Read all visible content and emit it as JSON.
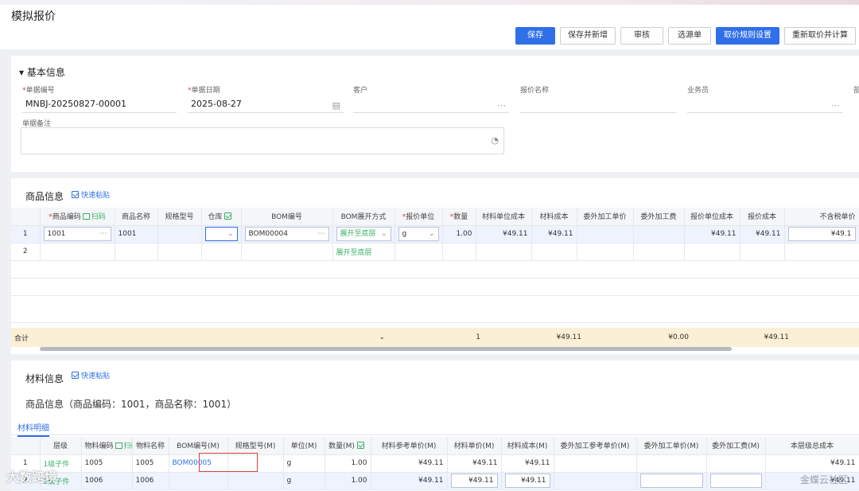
{
  "page": {
    "title": "模拟报价"
  },
  "toolbar": {
    "buttons": [
      "保存",
      "保存并新增",
      "审核",
      "选源单",
      "取价规则设置",
      "重新取价并计算",
      "​"
    ]
  },
  "basic": {
    "section_title": "基本信息",
    "fields": [
      {
        "label": "单据编号",
        "required": true,
        "value": "MNBJ-20250827-00001",
        "icon": ""
      },
      {
        "label": "单据日期",
        "required": true,
        "value": "2025-08-27",
        "icon": "calendar-icon"
      },
      {
        "label": "客户",
        "required": false,
        "value": "",
        "icon": "more-icon"
      },
      {
        "label": "报价名称",
        "required": false,
        "value": "",
        "icon": ""
      },
      {
        "label": "业务员",
        "required": false,
        "value": "",
        "icon": "more-icon"
      },
      {
        "label": "部",
        "required": false,
        "value": "",
        "icon": ""
      }
    ],
    "remark_label": "单据备注"
  },
  "goods": {
    "section_title": "商品信息",
    "quick_paste": "快速粘贴",
    "scan_label": "扫码",
    "columns": [
      "",
      "商品编码",
      "商品名称",
      "规格型号",
      "仓库",
      "BOM编号",
      "BOM展开方式",
      "报价单位",
      "数量",
      "材料单位成本",
      "材料成本",
      "委外加工单价",
      "委外加工费",
      "报价单位成本",
      "报价成本",
      "不含税单价"
    ],
    "rows": [
      {
        "no": "1",
        "code": "1001",
        "name": "1001",
        "spec": "",
        "warehouse": "",
        "bom": "BOM00004",
        "bom_expand": "展开至底层",
        "unit": "g",
        "qty": "1.00",
        "mat_unit_cost": "¥49.11",
        "mat_cost": "¥49.11",
        "out_price": "",
        "out_fee": "",
        "quote_unit_cost": "¥49.11",
        "quote_cost": "¥49.11",
        "ex_tax_price": "¥49.1"
      },
      {
        "no": "2",
        "code": "",
        "name": "",
        "spec": "",
        "warehouse": "",
        "bom": "",
        "bom_expand": "展开至底层",
        "unit": "",
        "qty": "",
        "mat_unit_cost": "",
        "mat_cost": "",
        "out_price": "",
        "out_fee": "",
        "quote_unit_cost": "",
        "quote_cost": "",
        "ex_tax_price": ""
      }
    ],
    "sum": {
      "label": "合计",
      "qty": "1",
      "mat_cost": "¥49.11",
      "out_fee": "¥0.00",
      "quote_cost": "¥49.11"
    }
  },
  "material": {
    "section_title": "材料信息",
    "quick_paste": "快速粘贴",
    "goods_line": "商品信息（商品编码：1001，商品名称：1001）",
    "tab": "材料明细",
    "columns": [
      "",
      "层级",
      "物料编码",
      "物料名称",
      "BOM编号(M)",
      "规格型号(M)",
      "单位(M)",
      "数量(M)",
      "材料参考单价(M)",
      "材料单价(M)",
      "材料成本(M)",
      "委外加工参考单价(M)",
      "委外加工单价(M)",
      "委外加工费(M)",
      "本层级总成本"
    ],
    "rows": [
      {
        "no": "1",
        "level": "1级子件",
        "code": "1005",
        "name": "1005",
        "bom": "BOM00005",
        "spec": "",
        "unit": "g",
        "qty": "1.00",
        "ref_price": "¥49.11",
        "price": "¥49.11",
        "cost": "¥49.11",
        "out_ref": "",
        "out_price": "",
        "out_fee": "",
        "total": "¥49.11"
      },
      {
        "no": "2",
        "level": "2级子件",
        "code": "1006",
        "name": "1006",
        "bom": "",
        "spec": "",
        "unit": "g",
        "qty": "1.00",
        "ref_price": "¥49.11",
        "price": "¥49.11",
        "cost": "¥49.11",
        "out_ref": "",
        "out_price": "",
        "out_fee": "",
        "total": "¥49.11"
      }
    ]
  },
  "watermarks": {
    "left": "大数跨境",
    "right": "金蝶云社区"
  },
  "colors": {
    "primary": "#2f6fe8",
    "required": "#e43d3d",
    "green": "#38b26a",
    "sum_bg": "#fbefd6",
    "highlight": "#e04040"
  }
}
